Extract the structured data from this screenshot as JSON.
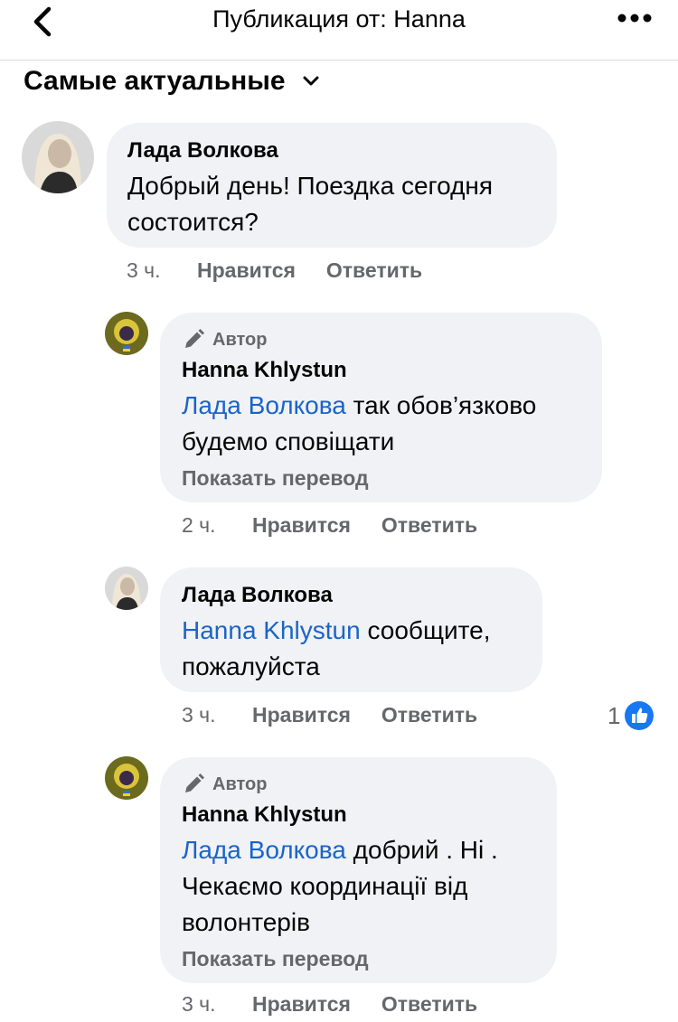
{
  "header": {
    "title": "Публикация от: Hanna"
  },
  "sort": {
    "label": "Самые актуальные"
  },
  "comments": [
    {
      "author": "Лада Волкова",
      "text": "Добрый день! Поездка сегодня состоится?",
      "time": "3 ч.",
      "like_label": "Нравится",
      "reply_label": "Ответить"
    },
    {
      "badge": "Автор",
      "author": "Hanna Khlystun",
      "mention": "Лада Волкова",
      "text": " так обов’язково будемо сповіщати",
      "translate": "Показать перевод",
      "time": "2 ч.",
      "like_label": "Нравится",
      "reply_label": "Ответить"
    },
    {
      "author": "Лада Волкова",
      "mention": "Hanna Khlystun",
      "text": " сообщите, пожалуйста",
      "time": "3 ч.",
      "like_label": "Нравится",
      "reply_label": "Ответить",
      "reaction_count": "1"
    },
    {
      "badge": "Автор",
      "author": "Hanna Khlystun",
      "mention": "Лада Волкова",
      "text": " добрий . Ні . Чекаємо координації від волонтерів",
      "translate": "Показать перевод",
      "time": "3 ч.",
      "like_label": "Нравится",
      "reply_label": "Ответить"
    }
  ],
  "colors": {
    "bubble": "#f0f2f5",
    "mention": "#1b64c8",
    "like_badge": "#1877f2",
    "secondary_text": "#65676b"
  }
}
